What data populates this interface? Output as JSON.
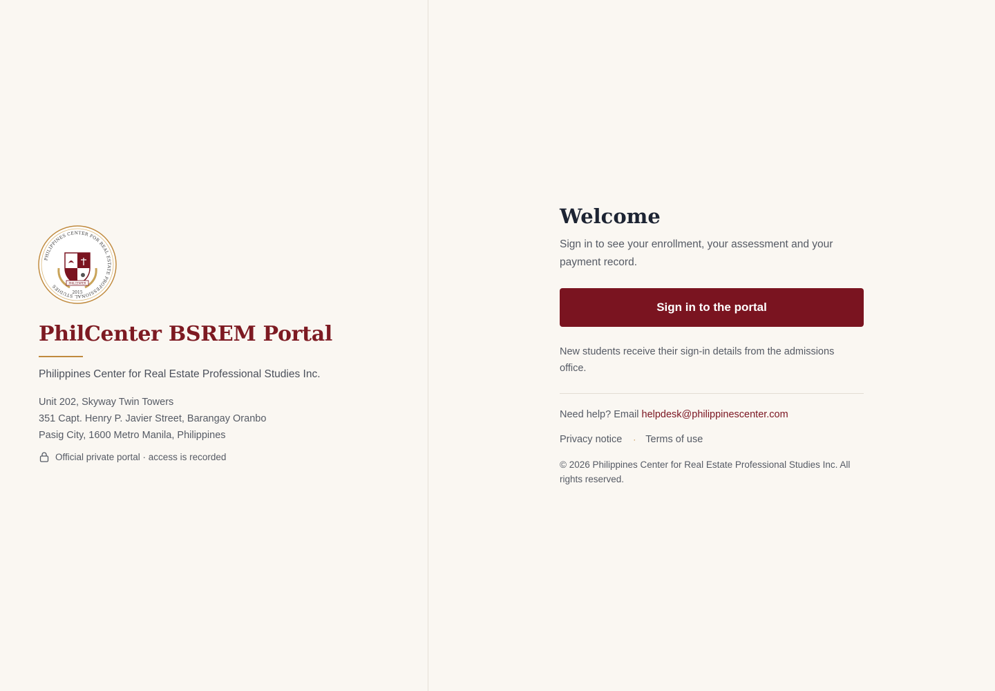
{
  "brand": {
    "title": "PhilCenter BSREM Portal",
    "org_name": "Philippines Center for Real Estate Professional Studies Inc.",
    "address": [
      "Unit 202, Skyway Twin Towers",
      "351 Capt. Henry P. Javier Street, Barangay Oranbo",
      "Pasig City, 1600 Metro Manila, Philippines"
    ],
    "private_note": "Official private portal · access is recorded",
    "seal_text": "PHILIPPINES CENTER FOR REAL ESTATE PROFESSIONAL STUDIES",
    "seal_year": "2015",
    "seal_banner": "PHILCENTER",
    "lock_icon": "lock-icon"
  },
  "signin": {
    "heading": "Welcome",
    "subheading": "Sign in to see your enrollment, your assessment and your payment record.",
    "button_label": "Sign in to the portal",
    "new_students_note": "New students receive their sign-in details from the admissions office."
  },
  "footer": {
    "help_prefix": "Need help? Email ",
    "help_email": "helpdesk@philippinescenter.com",
    "privacy_label": "Privacy notice",
    "separator": "·",
    "terms_label": "Terms of use",
    "copyright": "© 2026 Philippines Center for Real Estate Professional Studies Inc. All rights reserved."
  },
  "colors": {
    "background": "#faf7f2",
    "brand_maroon": "#7a1420",
    "accent_gold": "#c08a3e",
    "heading_dark": "#1d2433"
  }
}
